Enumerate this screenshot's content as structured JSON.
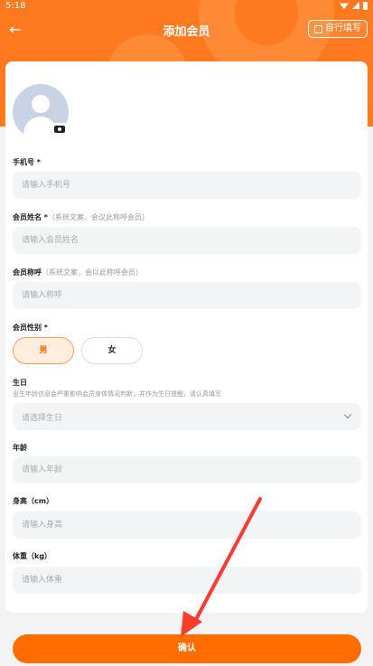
{
  "status_bar": {
    "time": "5:18"
  },
  "header": {
    "title": "添加会员",
    "self_fill_label": "自行填写"
  },
  "form": {
    "phone": {
      "label": "手机号",
      "required": "*",
      "placeholder": "请输入手机号"
    },
    "name": {
      "label": "会员姓名",
      "required": "*",
      "hint": "（系统文案，会议此称呼会员）",
      "placeholder": "请输入会员姓名"
    },
    "nickname": {
      "label": "会员称呼",
      "hint": "（系统文案，会以此称呼会员）",
      "placeholder": "请输入称呼"
    },
    "gender": {
      "label": "会员性别",
      "required": "*",
      "options": [
        "男",
        "女"
      ],
      "selected": "男"
    },
    "birthday": {
      "label": "生日",
      "sublabel": "出生年龄信息会严重影响会员身体情况判断，并作为生日提醒，请认真填写",
      "placeholder": "请选择生日"
    },
    "age": {
      "label": "年龄",
      "placeholder": "请输入年龄"
    },
    "height": {
      "label": "身高（cm）",
      "placeholder": "请输入身高"
    },
    "weight": {
      "label": "体重（kg）",
      "placeholder": "请输入体重"
    }
  },
  "footer": {
    "confirm_label": "确认"
  },
  "colors": {
    "accent": "#ff6d00",
    "hero": "#ff7a1f",
    "annotation_arrow": "#ff3b30"
  },
  "icons": {
    "back": "arrow-left-icon",
    "self_fill": "edit-icon",
    "camera": "camera-icon",
    "birthday_dropdown": "chevron-down-icon"
  }
}
